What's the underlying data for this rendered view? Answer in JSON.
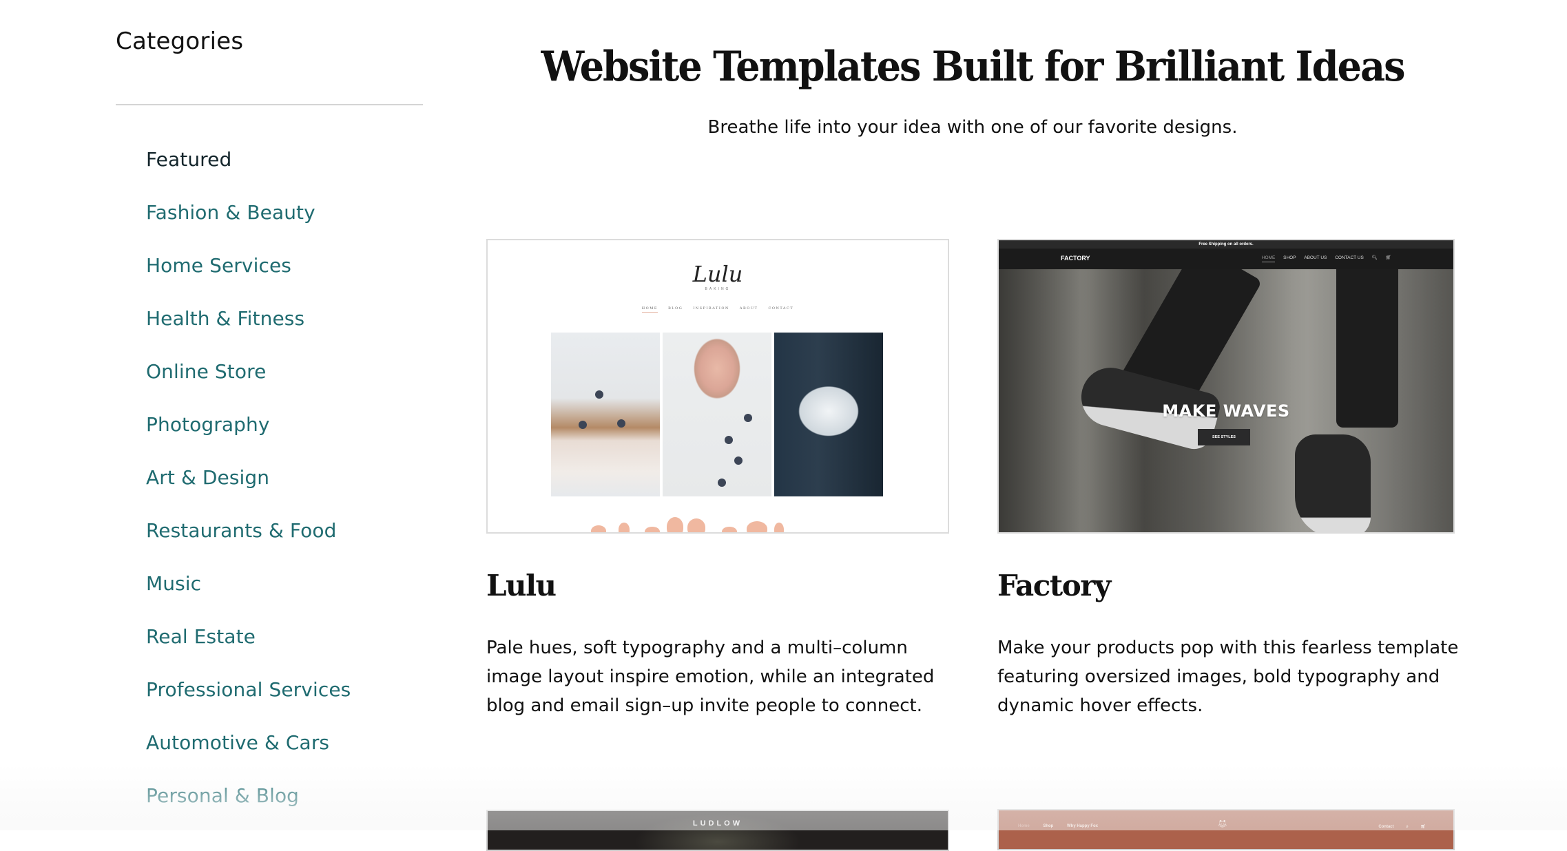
{
  "sidebar": {
    "title": "Categories",
    "items": [
      {
        "label": "Featured",
        "active": true
      },
      {
        "label": "Fashion & Beauty"
      },
      {
        "label": "Home Services"
      },
      {
        "label": "Health & Fitness"
      },
      {
        "label": "Online Store"
      },
      {
        "label": "Photography"
      },
      {
        "label": "Art & Design"
      },
      {
        "label": "Restaurants & Food"
      },
      {
        "label": "Music"
      },
      {
        "label": "Real Estate"
      },
      {
        "label": "Professional Services"
      },
      {
        "label": "Automotive & Cars"
      },
      {
        "label": "Personal & Blog"
      }
    ]
  },
  "main": {
    "title": "Website Templates Built for Brilliant Ideas",
    "subtitle": "Breathe life into your idea with one of our favorite designs."
  },
  "templates": [
    {
      "name": "Lulu",
      "description": "Pale hues, soft typography and a multi–column image layout inspire emotion, while an integrated blog and email sign–up invite people to connect.",
      "preview": {
        "logo": "Lulu",
        "logo_sub": "BAKING",
        "nav": [
          "HOME",
          "BLOG",
          "INSPIRATION",
          "ABOUT",
          "CONTACT"
        ]
      }
    },
    {
      "name": "Factory",
      "description": "Make your products pop with this fearless template featuring oversized images, bold typography and dynamic hover effects.",
      "preview": {
        "announcement": "Free Shipping on all orders.",
        "logo": "FACTORY",
        "nav": [
          "HOME",
          "SHOP",
          "ABOUT US",
          "CONTACT US"
        ],
        "headline": "MAKE WAVES",
        "button": "SEE STYLES"
      }
    },
    {
      "preview": {
        "logo": "LUDLOW"
      }
    },
    {
      "preview": {
        "nav_left": [
          "Home",
          "Shop",
          "Why Happy Fox"
        ],
        "nav_right": [
          "Contact"
        ]
      }
    }
  ],
  "colors": {
    "category_link": "#1f6b70",
    "category_active": "#13252b",
    "fox_accent": "#ac614b"
  }
}
